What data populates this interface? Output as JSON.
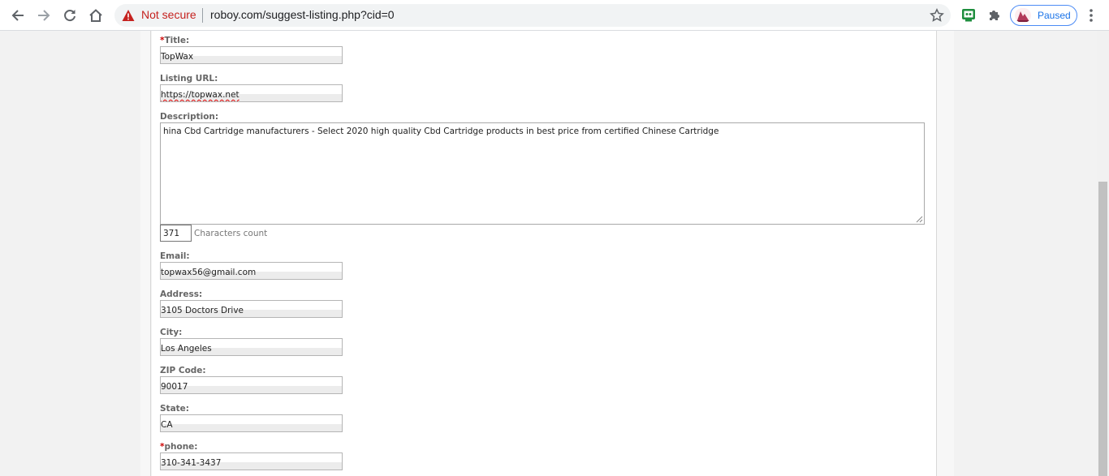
{
  "browser": {
    "security_label": "Not secure",
    "url": "roboy.com/suggest-listing.php?cid=0",
    "profile_status": "Paused",
    "icons": [
      "back-icon",
      "forward-icon",
      "reload-icon",
      "home-icon",
      "warning-icon",
      "star-icon",
      "extension-icon",
      "puzzle-icon",
      "avatar",
      "menu-icon"
    ],
    "accent_color": "#1a73e8",
    "warning_color": "#c5221f"
  },
  "form": {
    "required_marker": "*",
    "title_label": "Title:",
    "title_value": "TopWax",
    "url_label": "Listing URL:",
    "url_value": "https://topwax.net",
    "description_label": "Description:",
    "description_value": "hina Cbd Cartridge manufacturers - Select 2020 high quality Cbd Cartridge products in best price from certified Chinese Cartridge",
    "char_count": "371",
    "char_count_label": "Characters count",
    "email_label": "Email:",
    "email_value": "topwax56@gmail.com",
    "address_label": "Address:",
    "address_value": "3105  Doctors Drive",
    "city_label": "City:",
    "city_value": "Los Angeles",
    "zip_label": "ZIP Code:",
    "zip_value": "90017",
    "state_label": "State:",
    "state_value": "CA",
    "phone_label": "phone:",
    "phone_value": "310-341-3437"
  }
}
